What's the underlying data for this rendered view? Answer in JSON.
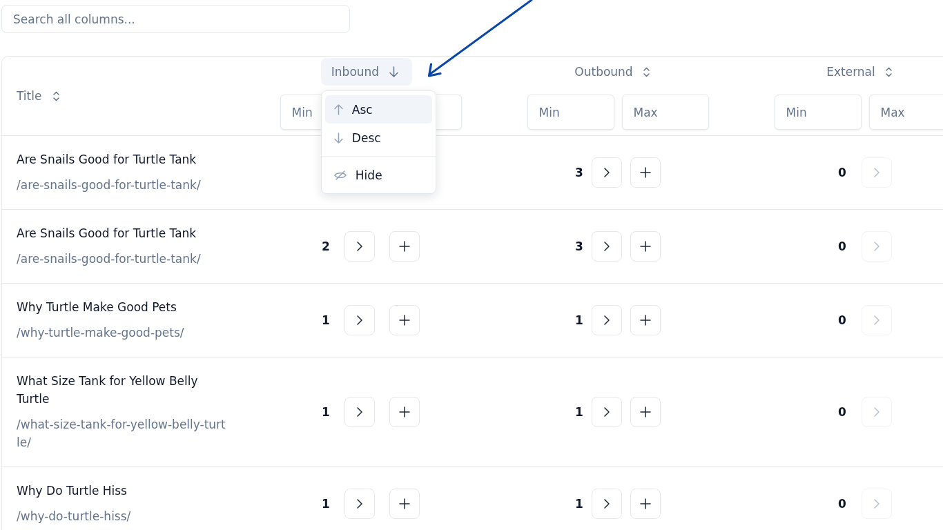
{
  "search": {
    "placeholder": "Search all columns..."
  },
  "table": {
    "columns": [
      {
        "kind": "text",
        "label": "Title",
        "sorted": false,
        "expanded": false
      },
      {
        "kind": "number",
        "label": "Inbound",
        "sorted": true,
        "descending": true,
        "expanded": true,
        "filter_placeholders": [
          "Min"
        ],
        "menu": {
          "groups": [
            [
              {
                "kind": "asc",
                "label": "Asc",
                "selected": true
              },
              {
                "kind": "desc",
                "label": "Desc",
                "selected": false
              }
            ],
            [
              {
                "kind": "hide",
                "label": "Hide",
                "selected": false
              }
            ]
          ]
        }
      },
      {
        "kind": "number",
        "label": "Outbound",
        "sorted": false,
        "expanded": false,
        "filter_placeholders": [
          "Min",
          "Max"
        ]
      },
      {
        "kind": "number",
        "label": "External",
        "sorted": false,
        "expanded": false,
        "filter_placeholders": [
          "Min",
          "Max"
        ]
      }
    ],
    "rows": [
      {
        "title": "Are Snails Good for Turtle Tank",
        "slug": "/are-snails-good-for-turtle-tank/",
        "outbound": {
          "count": "3",
          "buttons": [
            {
              "kind": "expand",
              "disabled": false
            },
            {
              "kind": "add",
              "disabled": false
            }
          ]
        },
        "external": {
          "count": "0",
          "buttons": [
            {
              "kind": "expand",
              "disabled": true
            }
          ]
        }
      },
      {
        "title": "Are Snails Good for Turtle Tank",
        "slug": "/are-snails-good-for-turtle-tank/",
        "inbound": {
          "count": "2",
          "buttons": [
            {
              "kind": "expand",
              "disabled": false
            },
            {
              "kind": "add",
              "disabled": false
            }
          ]
        },
        "outbound": {
          "count": "3",
          "buttons": [
            {
              "kind": "expand",
              "disabled": false
            },
            {
              "kind": "add",
              "disabled": false
            }
          ]
        },
        "external": {
          "count": "0",
          "buttons": [
            {
              "kind": "expand",
              "disabled": true
            }
          ]
        }
      },
      {
        "title": "Why Turtle Make Good Pets",
        "slug": "/why-turtle-make-good-pets/",
        "inbound": {
          "count": "1",
          "buttons": [
            {
              "kind": "expand",
              "disabled": false
            },
            {
              "kind": "add",
              "disabled": false
            }
          ]
        },
        "outbound": {
          "count": "1",
          "buttons": [
            {
              "kind": "expand",
              "disabled": false
            },
            {
              "kind": "add",
              "disabled": false
            }
          ]
        },
        "external": {
          "count": "0",
          "buttons": [
            {
              "kind": "expand",
              "disabled": true
            }
          ]
        }
      },
      {
        "title": "What Size Tank for Yellow Belly Turtle",
        "slug": "/what-size-tank-for-yellow-belly-turtle/",
        "inbound": {
          "count": "1",
          "buttons": [
            {
              "kind": "expand",
              "disabled": false
            },
            {
              "kind": "add",
              "disabled": false
            }
          ]
        },
        "outbound": {
          "count": "1",
          "buttons": [
            {
              "kind": "expand",
              "disabled": false
            },
            {
              "kind": "add",
              "disabled": false
            }
          ]
        },
        "external": {
          "count": "0",
          "buttons": [
            {
              "kind": "expand",
              "disabled": true
            }
          ]
        }
      },
      {
        "title": "Why Do Turtle Hiss",
        "slug": "/why-do-turtle-hiss/",
        "inbound": {
          "count": "1",
          "buttons": [
            {
              "kind": "expand",
              "disabled": false
            },
            {
              "kind": "add",
              "disabled": false
            }
          ]
        },
        "outbound": {
          "count": "1",
          "buttons": [
            {
              "kind": "expand",
              "disabled": false
            },
            {
              "kind": "add",
              "disabled": false
            }
          ]
        },
        "external": {
          "count": "0",
          "buttons": [
            {
              "kind": "expand",
              "disabled": true
            }
          ]
        }
      }
    ]
  },
  "annotations": [
    {
      "kind": "arrow"
    }
  ]
}
